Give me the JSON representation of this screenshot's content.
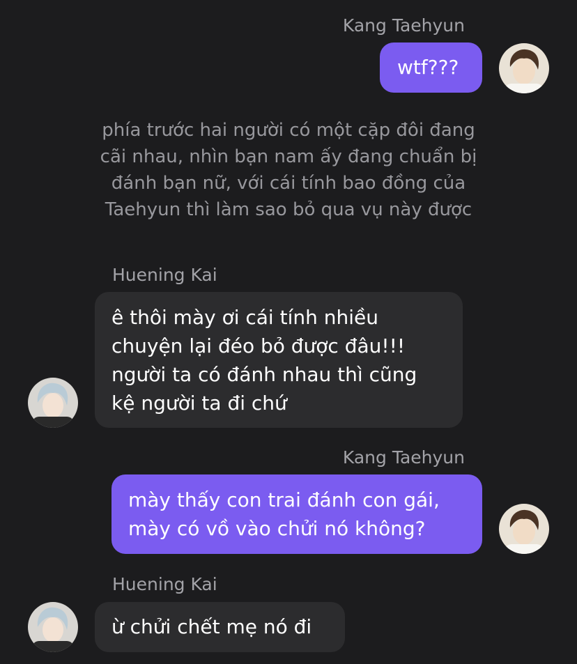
{
  "messages": [
    {
      "sender": "Kang Taehyun",
      "lines": [
        "wtf???"
      ]
    },
    {
      "narration": [
        "phía trước hai người có một cặp đôi đang",
        "cãi nhau, nhìn bạn nam ấy đang chuẩn bị",
        "đánh bạn nữ, với cái tính bao đồng của",
        "Taehyun thì làm sao bỏ qua vụ này được"
      ]
    },
    {
      "sender": "Huening Kai",
      "lines": [
        "ê thôi mày ơi cái tính nhiều",
        "chuyện lại đéo bỏ được đâu!!!",
        "người ta có đánh nhau thì cũng",
        "kệ người ta đi chứ"
      ]
    },
    {
      "sender": "Kang Taehyun",
      "lines": [
        "mày thấy con trai đánh con gái,",
        "mày có vồ vào chửi nó không?"
      ]
    },
    {
      "sender": "Huening Kai",
      "lines": [
        "ừ chửi chết mẹ nó đi"
      ]
    }
  ],
  "colors": {
    "background": "#1c1c1e",
    "outgoing_bubble": "#7b5cf0",
    "incoming_bubble": "#2c2c2e",
    "sender_name": "#a3a3a8",
    "narration_text": "#98989d",
    "message_text": "#ffffff"
  }
}
